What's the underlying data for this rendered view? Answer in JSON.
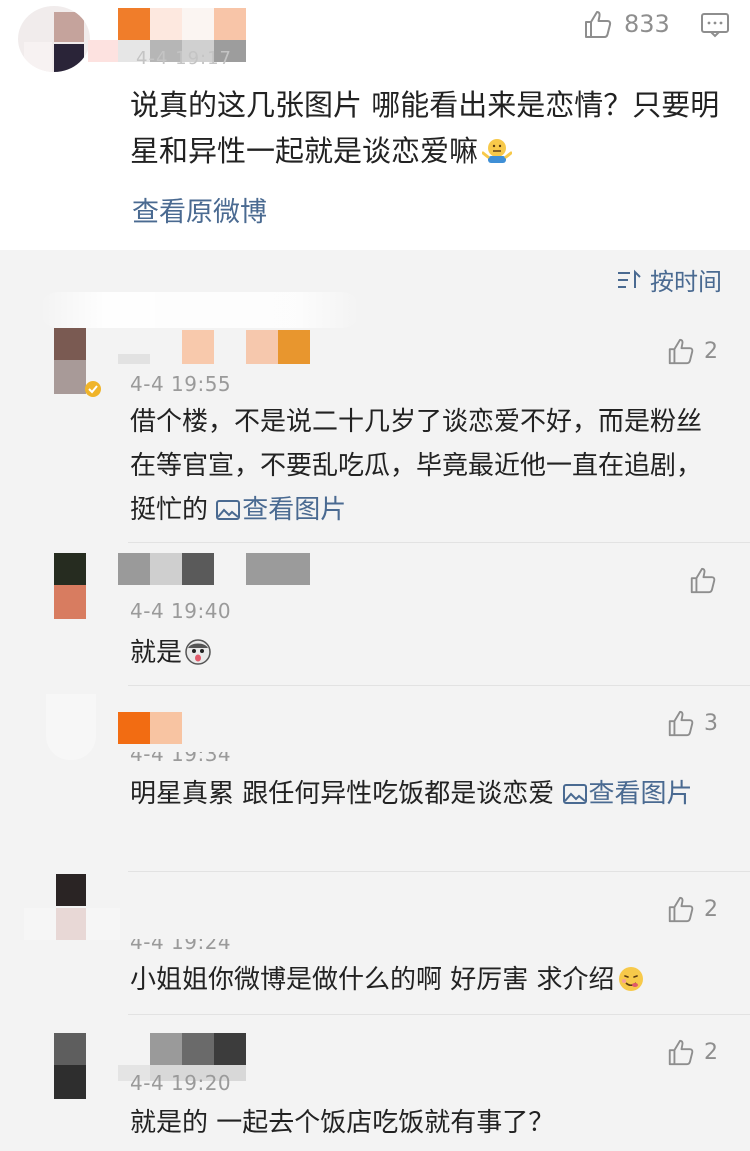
{
  "top_comment": {
    "time": "4-4 19:17",
    "likes": "833",
    "text": "说真的这几张图片 哪能看出来是恋情？只要明星和异性一起就是谈恋爱嘛",
    "view_original": "查看原微博"
  },
  "sort": {
    "label": "按时间"
  },
  "replies": [
    {
      "time": "4-4 19:55",
      "likes": "2",
      "text": "借个楼，不是说二十几岁了谈恋爱不好，而是粉丝在等官宣，不要乱吃瓜，毕竟最近他一直在追剧，挺忙的",
      "link": "查看图片"
    },
    {
      "time": "4-4 19:40",
      "likes": "",
      "text": "就是"
    },
    {
      "time": "4-4 19:34",
      "likes": "3",
      "text": "明星真累 跟任何异性吃饭都是谈恋爱",
      "link": "查看图片"
    },
    {
      "time": "4-4 19:24",
      "likes": "2",
      "text": "小姐姐你微博是做什么的啊 好厉害 求介绍"
    },
    {
      "time": "4-4 19:20",
      "likes": "2",
      "text": "就是的 一起去个饭店吃饭就有事了？"
    }
  ],
  "colors": {
    "link": "#4a6a91",
    "meta": "#9a9a9a",
    "background": "#f3f3f3"
  }
}
